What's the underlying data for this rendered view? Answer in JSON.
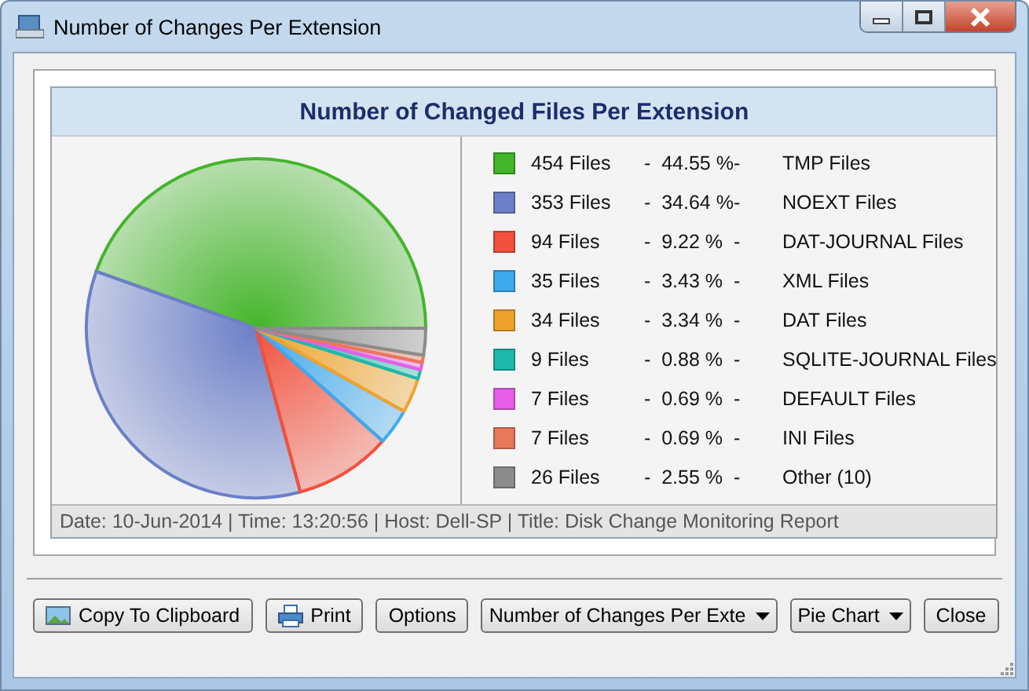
{
  "window": {
    "title": "Number of Changes Per Extension"
  },
  "report": {
    "title": "Number of Changed Files Per Extension",
    "chart_data": {
      "type": "pie",
      "categories": [
        "TMP Files",
        "NOEXT Files",
        "DAT-JOURNAL Files",
        "XML Files",
        "DAT Files",
        "SQLITE-JOURNAL Files",
        "DEFAULT Files",
        "INI Files",
        "Other (10)"
      ],
      "values": [
        44.55,
        34.64,
        9.22,
        3.43,
        3.34,
        0.88,
        0.69,
        0.69,
        2.55
      ]
    },
    "legend": [
      {
        "count": "454 Files",
        "percent": "-  44.55 %-",
        "color": "#44b52a"
      },
      {
        "count": "353 Files",
        "percent": "-  34.64 %-",
        "color": "#6c7fc8"
      },
      {
        "count": "94 Files",
        "percent": "-  9.22 %  -",
        "color": "#f2513d"
      },
      {
        "count": "35 Files",
        "percent": "-  3.43 %  -",
        "color": "#3fa9ee"
      },
      {
        "count": "34 Files",
        "percent": "-  3.34 %  -",
        "color": "#f0a32c"
      },
      {
        "count": "9 Files",
        "percent": "-  0.88 %  -",
        "color": "#1fb8ac"
      },
      {
        "count": "7 Files",
        "percent": "-  0.69 %  -",
        "color": "#e85ee8"
      },
      {
        "count": "7 Files",
        "percent": "-  0.69 %  -",
        "color": "#e8785a"
      },
      {
        "count": "26 Files",
        "percent": "-  2.55 %  -",
        "color": "#8c8c8c"
      }
    ],
    "footer": "Date: 10-Jun-2014 | Time: 13:20:56 | Host: Dell-SP | Title: Disk Change Monitoring Report"
  },
  "buttons": [
    {
      "kind": "button",
      "label": "Copy To Clipboard"
    },
    {
      "kind": "button",
      "label": "Print"
    },
    {
      "kind": "button",
      "label": "Options"
    },
    {
      "kind": "dropdown",
      "label": "Number of Changes Per Exte"
    },
    {
      "kind": "dropdown",
      "label": "Pie Chart"
    },
    {
      "kind": "button",
      "label": "Close"
    }
  ]
}
